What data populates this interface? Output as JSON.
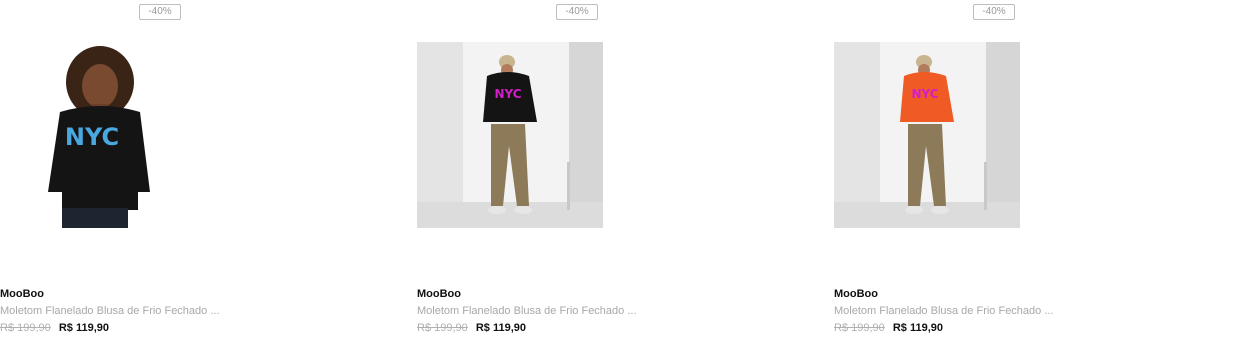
{
  "products": [
    {
      "discount_badge": "-40%",
      "image_alt": "hoodie-black-nyc-woman-photo",
      "brand": "MooBoo",
      "title": "Moletom Flanelado Blusa de Frio Fechado ...",
      "old_price": "R$ 199,90",
      "price": "R$ 119,90",
      "hoodie_color": "#141414",
      "print_color": "#4aa8e0"
    },
    {
      "discount_badge": "-40%",
      "image_alt": "hoodie-black-nyc-man-photo",
      "brand": "MooBoo",
      "title": "Moletom Flanelado Blusa de Frio Fechado ...",
      "old_price": "R$ 199,90",
      "price": "R$ 119,90",
      "hoodie_color": "#141414",
      "print_color": "#d21ec8"
    },
    {
      "discount_badge": "-40%",
      "image_alt": "hoodie-orange-nyc-man-photo",
      "brand": "MooBoo",
      "title": "Moletom Flanelado Blusa de Frio Fechado ...",
      "old_price": "R$ 199,90",
      "price": "R$ 119,90",
      "hoodie_color": "#f05a24",
      "print_color": "#d21ec8"
    }
  ]
}
